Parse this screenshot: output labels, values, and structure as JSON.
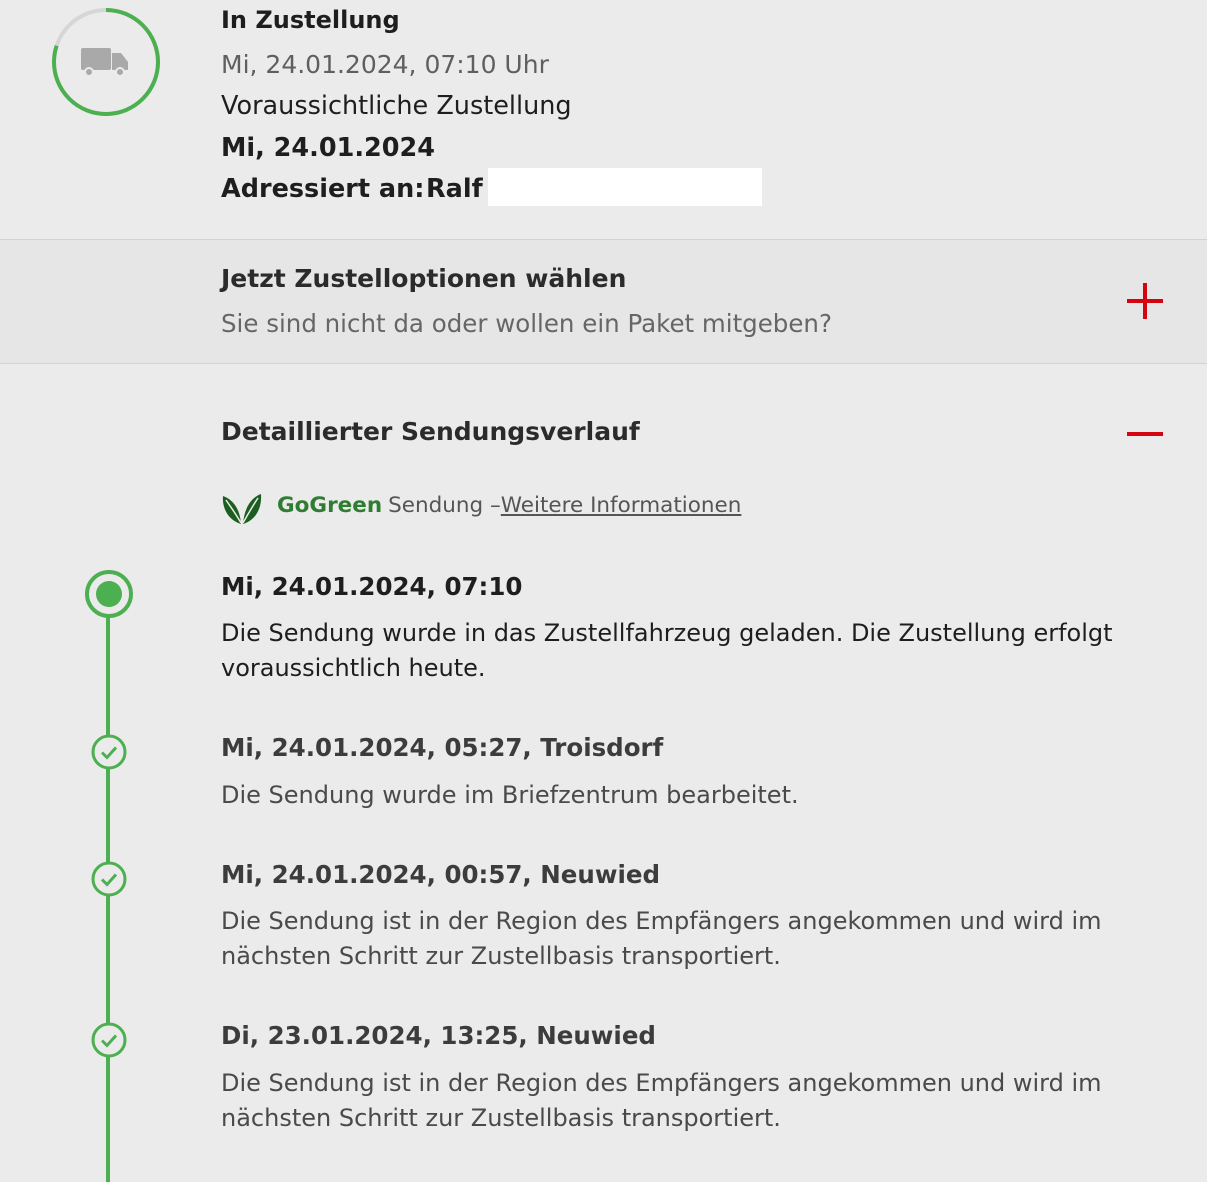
{
  "status": {
    "title": "In Zustellung",
    "timestamp": "Mi, 24.01.2024, 07:10 Uhr",
    "eta_label": "Voraussichtliche Zustellung",
    "eta_date": "Mi, 24.01.2024",
    "addressed_label": "Adressiert an:",
    "addressed_name": "Ralf",
    "icon": "truck-icon",
    "progress": 0.8,
    "progress_color": "#4caf50"
  },
  "options": {
    "title": "Jetzt Zustelloptionen wählen",
    "subtitle": "Sie sind nicht da oder wollen ein Paket mitgeben?",
    "toggle_icon": "plus-icon"
  },
  "history": {
    "title": "Detaillierter Sendungsverlauf",
    "toggle_icon": "minus-icon",
    "gogreen": {
      "brand": "GoGreen",
      "text": "Sendung –",
      "link": "Weitere Informationen",
      "icon": "leaf-icon"
    },
    "events": [
      {
        "head": "Mi, 24.01.2024, 07:10",
        "desc": "Die Sendung wurde in das Zustellfahrzeug geladen. Die Zustellung erfolgt voraussichtlich heute.",
        "state": "current"
      },
      {
        "head": "Mi, 24.01.2024, 05:27, Troisdorf",
        "desc": "Die Sendung wurde im Briefzentrum bearbeitet.",
        "state": "done"
      },
      {
        "head": "Mi, 24.01.2024, 00:57, Neuwied",
        "desc": "Die Sendung ist in der Region des Empfängers angekommen und wird im nächsten Schritt zur Zustellbasis transportiert.",
        "state": "done"
      },
      {
        "head": "Di, 23.01.2024, 13:25, Neuwied",
        "desc": "Die Sendung ist in der Region des Empfängers angekommen und wird im nächsten Schritt zur Zustellbasis transportiert.",
        "state": "done"
      }
    ]
  },
  "colors": {
    "accent_green": "#4caf50",
    "brand_green": "#2e7d32",
    "action_red": "#d40511",
    "background": "#ebebeb"
  }
}
